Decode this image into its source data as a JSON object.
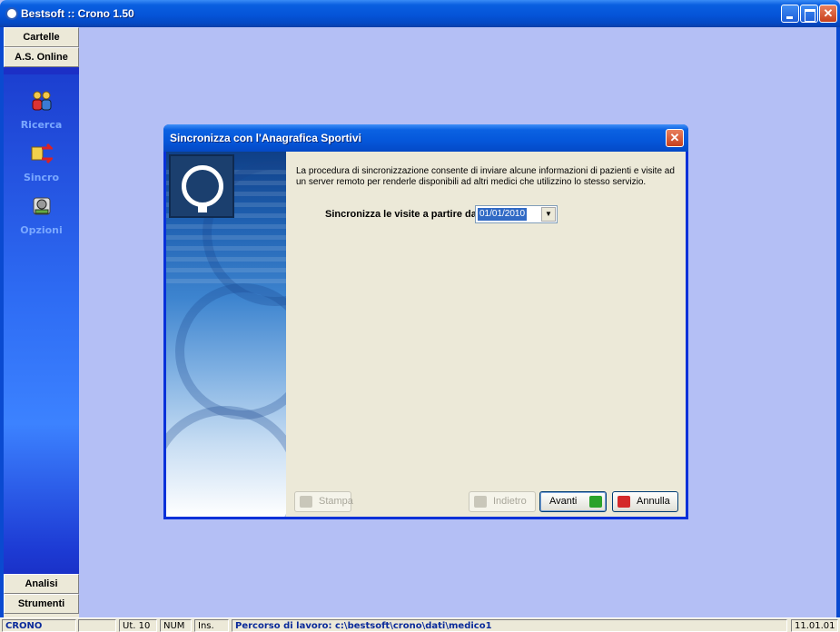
{
  "window": {
    "title": "Bestsoft :: Crono 1.50"
  },
  "sidebar": {
    "top_headers": [
      "Cartelle",
      "A.S. Online"
    ],
    "items": [
      {
        "label": "",
        "icon": "users-icon"
      },
      {
        "label": "Ricerca",
        "icon": "sync-arrows-icon"
      },
      {
        "label": "Sincro",
        "icon": "settings-cog-icon"
      },
      {
        "label": "Opzioni",
        "icon": ""
      }
    ],
    "bottom_headers": [
      "Analisi",
      "Strumenti"
    ]
  },
  "dialog": {
    "title": "Sincronizza con l'Anagrafica Sportivi",
    "description": "La procedura di sincronizzazione consente di inviare alcune informazioni di pazienti e visite ad un server remoto per renderle disponibili ad altri medici che utilizzino lo stesso servizio.",
    "sync_label": "Sincronizza le visite a partire dal",
    "date_value": "01/01/2010",
    "buttons": {
      "stampa": "Stampa",
      "indietro": "Indietro",
      "avanti": "Avanti",
      "annulla": "Annulla"
    }
  },
  "statusbar": {
    "app": "CRONO",
    "empty": "",
    "user": "Ut. 10",
    "num": "NUM",
    "ins": "Ins.",
    "path": "Percorso di lavoro: c:\\bestsoft\\crono\\dati\\medico1",
    "time": "11.01.01"
  },
  "colors": {
    "titlebar_blue": "#0554d8",
    "workspace": "#b4bff5",
    "dialog_body": "#ece9d8",
    "selection": "#316ac5"
  }
}
